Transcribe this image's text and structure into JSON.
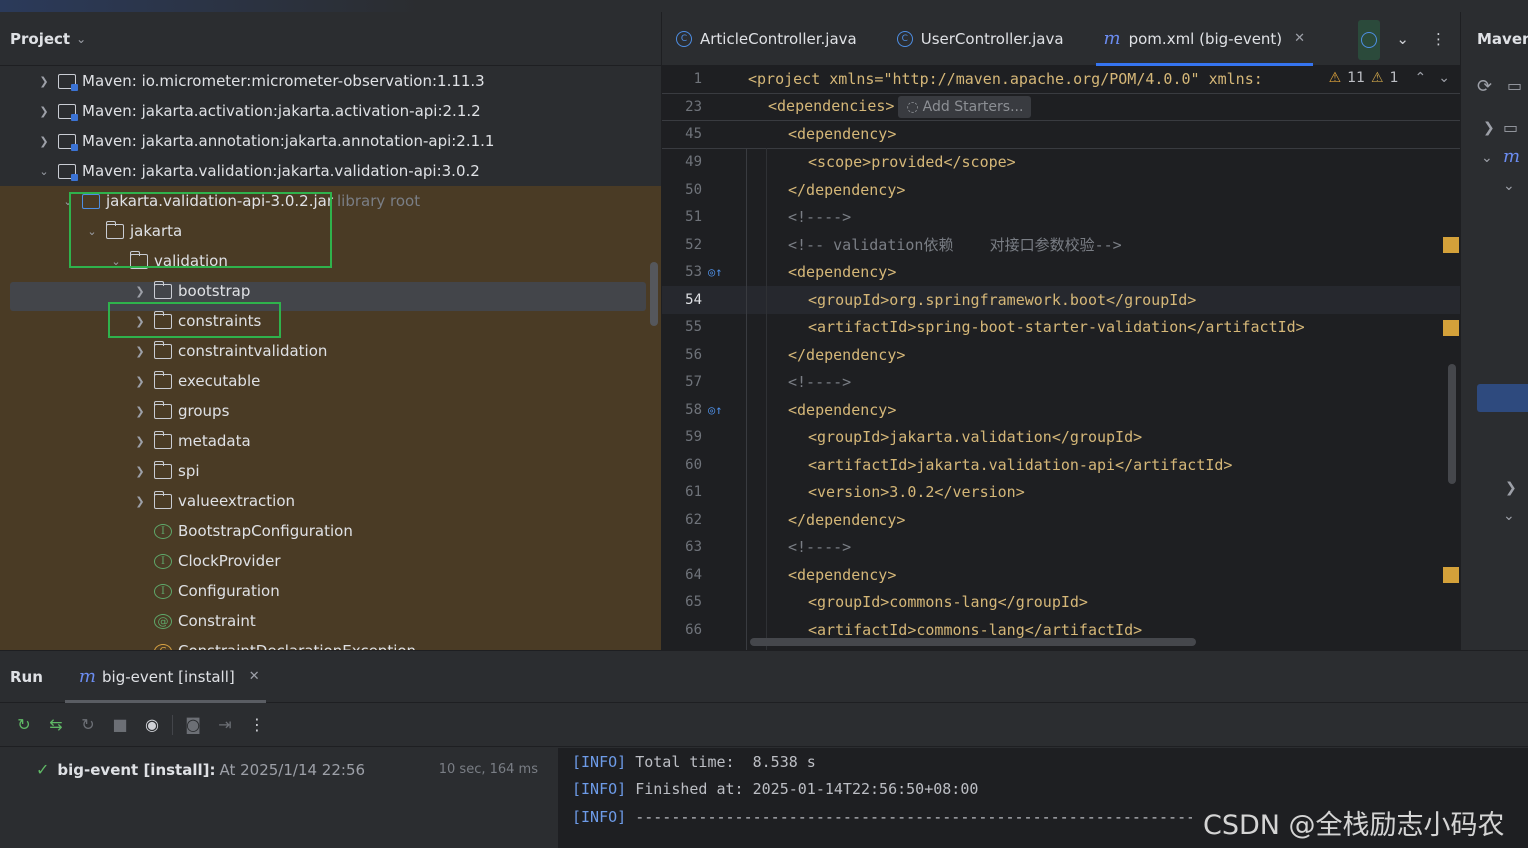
{
  "project": {
    "title": "Project",
    "rows": [
      {
        "label": "Maven: io.micrometer:micrometer-observation:1.11.3"
      },
      {
        "label": "Maven: jakarta.activation:jakarta.activation-api:2.1.2"
      },
      {
        "label": "Maven: jakarta.annotation:jakarta.annotation-api:2.1.1"
      },
      {
        "label": "Maven: jakarta.validation:jakarta.validation-api:3.0.2"
      },
      {
        "label": "jakarta.validation-api-3.0.2.jar",
        "suffix": "library root"
      },
      {
        "label": "jakarta"
      },
      {
        "label": "validation"
      },
      {
        "label": "bootstrap"
      },
      {
        "label": "constraints"
      },
      {
        "label": "constraintvalidation"
      },
      {
        "label": "executable"
      },
      {
        "label": "groups"
      },
      {
        "label": "metadata"
      },
      {
        "label": "spi"
      },
      {
        "label": "valueextraction"
      },
      {
        "label": "BootstrapConfiguration"
      },
      {
        "label": "ClockProvider"
      },
      {
        "label": "Configuration"
      },
      {
        "label": "Constraint"
      },
      {
        "label": "ConstraintDeclarationException"
      }
    ]
  },
  "editor": {
    "tabs": [
      {
        "label": "ArticleController.java"
      },
      {
        "label": "UserController.java"
      },
      {
        "label": "pom.xml (big-event)",
        "active": true
      }
    ],
    "add_starters": "Add Starters...",
    "warnings": {
      "warn_count": "11",
      "weak_count": "1"
    },
    "lines": [
      {
        "n": "1",
        "text": "<project xmlns=\"http://maven.apache.org/POM/4.0.0\" xmlns:"
      },
      {
        "n": "23",
        "text": "<dependencies>"
      },
      {
        "n": "45",
        "text": "<dependency>"
      },
      {
        "n": "49",
        "text": "<scope>provided</scope>"
      },
      {
        "n": "50",
        "text": "</dependency>"
      },
      {
        "n": "51",
        "text": "<!---->"
      },
      {
        "n": "52",
        "text": "<!-- validation依赖    对接口参数校验-->"
      },
      {
        "n": "53",
        "text": "<dependency>"
      },
      {
        "n": "54",
        "text": "<groupId>org.springframework.boot</groupId>"
      },
      {
        "n": "55",
        "text": "<artifactId>spring-boot-starter-validation</artifactId>"
      },
      {
        "n": "56",
        "text": "</dependency>"
      },
      {
        "n": "57",
        "text": "<!---->"
      },
      {
        "n": "58",
        "text": "<dependency>"
      },
      {
        "n": "59",
        "text": "<groupId>jakarta.validation</groupId>"
      },
      {
        "n": "60",
        "text": "<artifactId>jakarta.validation-api</artifactId>"
      },
      {
        "n": "61",
        "text": "<version>3.0.2</version>"
      },
      {
        "n": "62",
        "text": "</dependency>"
      },
      {
        "n": "63",
        "text": "<!---->"
      },
      {
        "n": "64",
        "text": "<dependency>"
      },
      {
        "n": "65",
        "text": "<groupId>commons-lang</groupId>"
      },
      {
        "n": "66",
        "text": "<artifactId>commons-lang</artifactId>"
      }
    ]
  },
  "maven": {
    "title": "Maven"
  },
  "run": {
    "title": "Run",
    "tab": "big-event [install]",
    "item_name": "big-event [install]:",
    "item_time": "At 2025/1/14 22:56",
    "item_duration": "10 sec, 164 ms",
    "console": [
      {
        "tag": "[INFO]",
        "text": " Total time:  8.538 s"
      },
      {
        "tag": "[INFO]",
        "text": " Finished at: 2025-01-14T22:56:50+08:00"
      },
      {
        "tag": "[INFO]",
        "text": " ------------------------------------------------------------------------"
      }
    ]
  },
  "watermark": "CSDN @全栈励志小码农",
  "colors": {
    "accent": "#3574f0",
    "highlight_box": "#2fb24c",
    "tag": "#d5b778",
    "attr_value": "#6aab73"
  }
}
